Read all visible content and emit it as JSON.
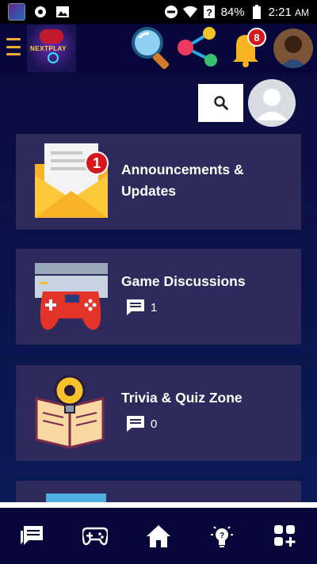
{
  "status_bar": {
    "battery": "84%",
    "time": "2:21",
    "ampm": "AM"
  },
  "header": {
    "logo_text": "NEXTPLAY",
    "notification_count": "8"
  },
  "categories": [
    {
      "title_line1": "Announcements &",
      "title_line2": "Updates",
      "badge": "1"
    },
    {
      "title_line1": "Game Discussions",
      "title_line2": "",
      "comments": "1"
    },
    {
      "title_line1": "Trivia & Quiz Zone",
      "title_line2": "",
      "comments": "0"
    }
  ],
  "colors": {
    "background": "#0c0c3a",
    "card": "#2e2a5c",
    "accent_orange": "#f2a93b",
    "badge_red": "#d6181c"
  },
  "bottom_nav": {
    "items": [
      "chat-icon",
      "gamepad-icon",
      "home-icon",
      "lightbulb-icon",
      "add-grid-icon"
    ]
  }
}
